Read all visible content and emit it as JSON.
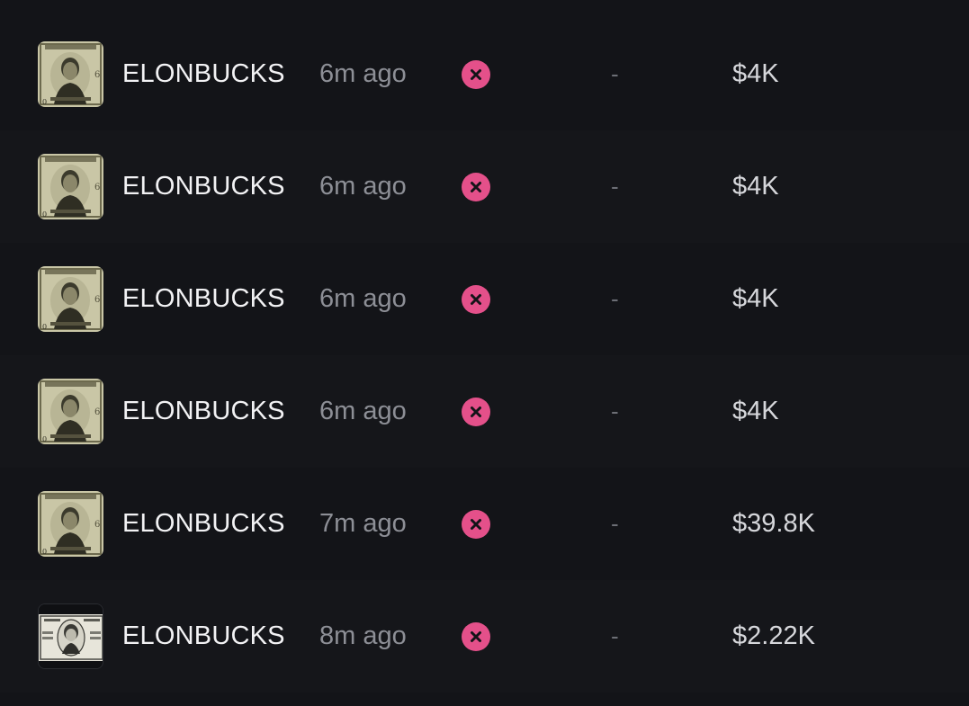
{
  "rows": [
    {
      "token": "ELONBUCKS",
      "age": "6m ago",
      "status_icon": "x-circle-icon",
      "change": "-",
      "amount": "$4K",
      "thumbnail": "elonbucks-dollar-portrait"
    },
    {
      "token": "ELONBUCKS",
      "age": "6m ago",
      "status_icon": "x-circle-icon",
      "change": "-",
      "amount": "$4K",
      "thumbnail": "elonbucks-dollar-portrait"
    },
    {
      "token": "ELONBUCKS",
      "age": "6m ago",
      "status_icon": "x-circle-icon",
      "change": "-",
      "amount": "$4K",
      "thumbnail": "elonbucks-dollar-portrait"
    },
    {
      "token": "ELONBUCKS",
      "age": "6m ago",
      "status_icon": "x-circle-icon",
      "change": "-",
      "amount": "$4K",
      "thumbnail": "elonbucks-dollar-portrait"
    },
    {
      "token": "ELONBUCKS",
      "age": "7m ago",
      "status_icon": "x-circle-icon",
      "change": "-",
      "amount": "$39.8K",
      "thumbnail": "elonbucks-dollar-portrait"
    },
    {
      "token": "ELONBUCKS",
      "age": "8m ago",
      "status_icon": "x-circle-icon",
      "change": "-",
      "amount": "$2.22K",
      "thumbnail": "elonbucks-dollar-bill"
    }
  ],
  "colors": {
    "background": "#131418",
    "status_failed": "#e4508a",
    "token_text": "#f2f2f4",
    "age_text": "#8d8f96"
  }
}
